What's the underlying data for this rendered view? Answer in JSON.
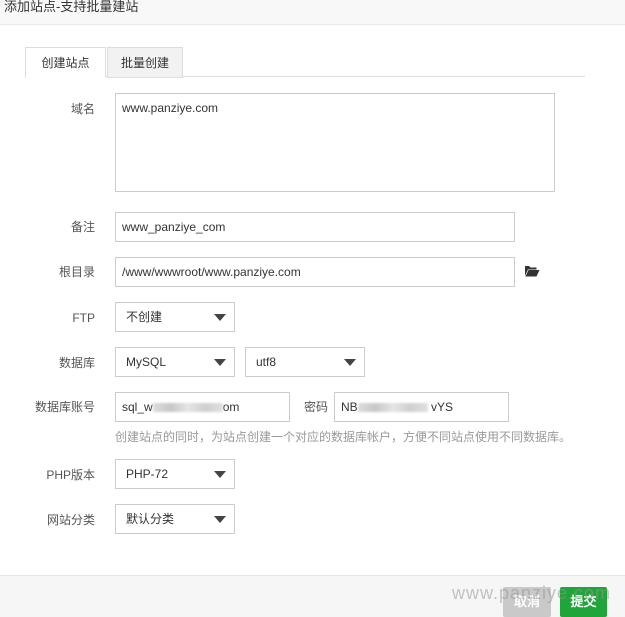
{
  "window": {
    "title": "添加站点-支持批量建站"
  },
  "tabs": [
    {
      "label": "创建站点",
      "active": true
    },
    {
      "label": "批量创建",
      "active": false
    }
  ],
  "form": {
    "domain": {
      "label": "域名",
      "value": "www.panziye.com"
    },
    "remark": {
      "label": "备注",
      "value": "www_panziye_com"
    },
    "root": {
      "label": "根目录",
      "value": "/www/wwwroot/www.panziye.com",
      "icon": "folder-open-icon"
    },
    "ftp": {
      "label": "FTP",
      "value": "不创建"
    },
    "database": {
      "label": "数据库",
      "type": "MySQL",
      "charset": "utf8"
    },
    "db_account": {
      "label": "数据库账号",
      "user_prefix": "sql_w",
      "user_suffix": "om",
      "password_label": "密码",
      "password_prefix": "NB",
      "password_suffix": "vYS"
    },
    "db_hint": "创建站点的同时，为站点创建一个对应的数据库帐户，方便不同站点使用不同数据库。",
    "php": {
      "label": "PHP版本",
      "value": "PHP-72"
    },
    "category": {
      "label": "网站分类",
      "value": "默认分类"
    }
  },
  "footer": {
    "cancel_label": "取消",
    "submit_label": "提交"
  },
  "watermark": "www.panziye.com",
  "colors": {
    "submit": "#20a53a",
    "cancel": "#c9c9c9"
  }
}
